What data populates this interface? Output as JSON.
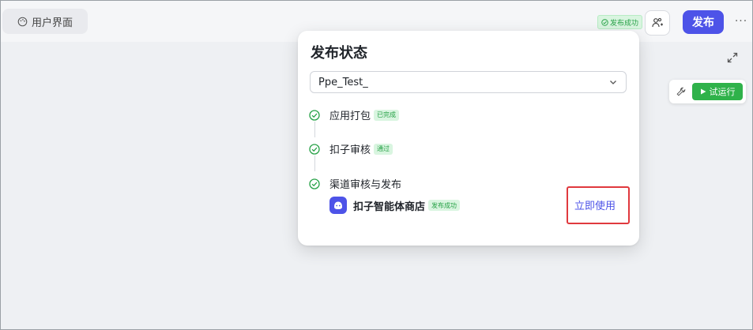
{
  "header": {
    "tab_label": "用户界面",
    "status_badge": "发布成功",
    "publish_label": "发布",
    "more_label": "···"
  },
  "toolbar": {
    "run_label": "试运行"
  },
  "publish_panel": {
    "title": "发布状态",
    "selected_bot": "Ppe_Test_",
    "steps": [
      {
        "label": "应用打包",
        "badge": "已完成"
      },
      {
        "label": "扣子审核",
        "badge": "通过"
      },
      {
        "label": "渠道审核与发布",
        "badge": ""
      }
    ],
    "channel": {
      "name": "扣子智能体商店",
      "badge": "发布成功",
      "action_label": "立即使用"
    }
  },
  "colors": {
    "primary": "#4d53e8",
    "success_green": "#26a146",
    "success_bg": "#d9f5e0",
    "run_green": "#2fb24a",
    "highlight_red": "#e0393e"
  },
  "icons": {
    "tab": "palette-icon",
    "status": "check-circle-icon",
    "collab": "users-add-icon",
    "expand": "expand-icon",
    "debug": "wrench-icon",
    "run": "play-icon",
    "dropdown": "chevron-down-icon",
    "step": "check-circle-icon",
    "store": "bot-logo-icon"
  }
}
